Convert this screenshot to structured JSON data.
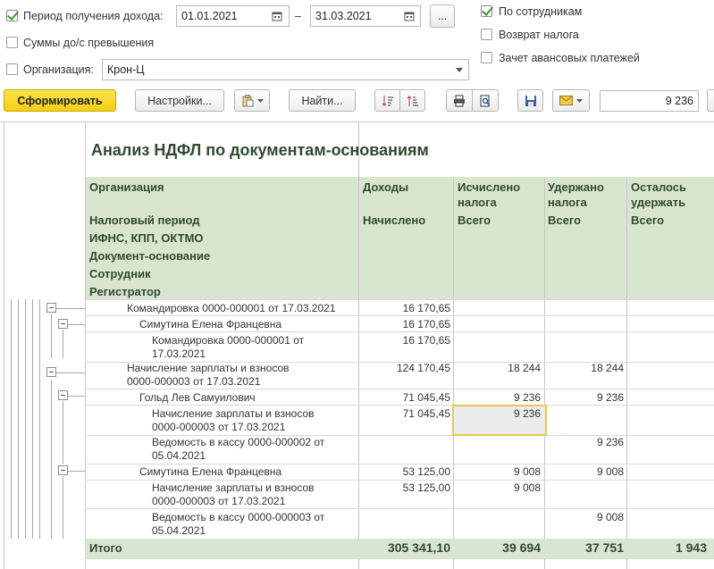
{
  "filters": {
    "period_label": "Период получения дохода:",
    "period_checked": true,
    "date_from": "01.01.2021",
    "date_dash": "–",
    "date_to": "31.03.2021",
    "more_btn": "...",
    "sums_label": "Суммы до/с превышения",
    "sums_checked": false,
    "org_label": "Организация:",
    "org_checked": false,
    "org_value": "Крон-Ц",
    "by_employees_label": "По сотрудникам",
    "by_employees_checked": true,
    "tax_return_label": "Возврат налога",
    "tax_return_checked": false,
    "advance_label": "Зачет авансовых платежей",
    "advance_checked": false
  },
  "toolbar": {
    "generate": "Сформировать",
    "settings": "Настройки...",
    "find": "Найти...",
    "sum_value": "9 236"
  },
  "report": {
    "title": "Анализ НДФЛ по документам-основаниям",
    "headers": {
      "org": "Организация",
      "tax_period": "Налоговый период",
      "ifns": "ИФНС, КПП, ОКТМО",
      "doc_basis": "Документ-основание",
      "employee": "Сотрудник",
      "registrar": "Регистратор",
      "income": "Доходы",
      "accrued": "Начислено",
      "calc_line1": "Исчислено",
      "calc_line2": "налога",
      "calc_total": "Всего",
      "withheld_line1": "Удержано",
      "withheld_line2": "налога",
      "withheld_total": "Всего",
      "left_line1": "Осталось",
      "left_line2": "удержать",
      "left_total": "Всего"
    },
    "rows": [
      {
        "l1": "Командировка 0000-000001 от 17.03.2021",
        "l2": "",
        "income": "16 170,65",
        "calc": "",
        "withheld": "",
        "left": ""
      },
      {
        "l1": "Симутина Елена Францевна",
        "l2": "",
        "income": "16 170,65",
        "calc": "",
        "withheld": "",
        "left": ""
      },
      {
        "l1": "Командировка 0000-000001 от",
        "l2": "17.03.2021",
        "income": "16 170,65",
        "calc": "",
        "withheld": "",
        "left": ""
      },
      {
        "l1": "Начисление зарплаты и взносов",
        "l2": "0000-000003 от 17.03.2021",
        "income": "124 170,45",
        "calc": "18 244",
        "withheld": "18 244",
        "left": ""
      },
      {
        "l1": "Гольд Лев Самуилович",
        "l2": "",
        "income": "71 045,45",
        "calc": "9 236",
        "withheld": "9 236",
        "left": ""
      },
      {
        "l1": "Начисление зарплаты и взносов",
        "l2": "0000-000003 от 17.03.2021",
        "income": "71 045,45",
        "calc": "9 236",
        "withheld": "",
        "left": ""
      },
      {
        "l1": "Ведомость в кассу 0000-000002 от",
        "l2": "05.04.2021",
        "income": "",
        "calc": "",
        "withheld": "9 236",
        "left": ""
      },
      {
        "l1": "Симутина Елена Францевна",
        "l2": "",
        "income": "53 125,00",
        "calc": "9 008",
        "withheld": "9 008",
        "left": ""
      },
      {
        "l1": "Начисление зарплаты и взносов",
        "l2": "0000-000003 от 17.03.2021",
        "income": "53 125,00",
        "calc": "9 008",
        "withheld": "",
        "left": ""
      },
      {
        "l1": "Ведомость в кассу 0000-000003 от",
        "l2": "05.04.2021",
        "income": "",
        "calc": "",
        "withheld": "9 008",
        "left": ""
      }
    ],
    "totals": {
      "label": "Итого",
      "income": "305 341,10",
      "calc": "39 694",
      "withheld": "37 751",
      "left": "1 943"
    }
  }
}
